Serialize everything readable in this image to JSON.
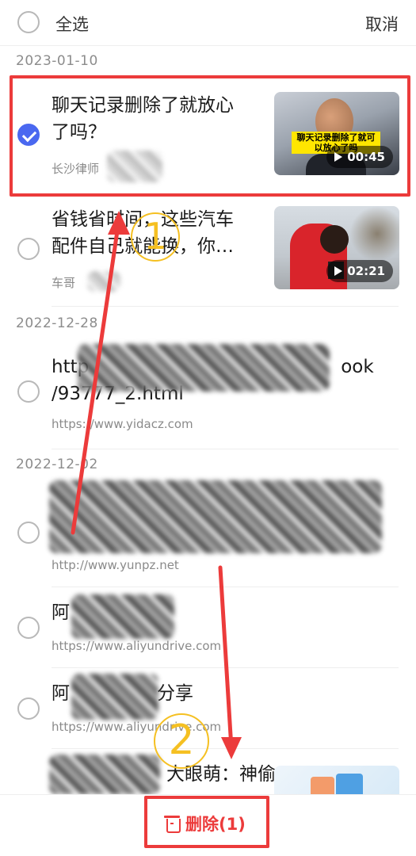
{
  "header": {
    "select_all": "全选",
    "cancel": "取消"
  },
  "groups": [
    {
      "date": "2023-01-10"
    },
    {
      "date": "2022-12-28"
    },
    {
      "date": "2022-12-02"
    }
  ],
  "items": [
    {
      "title_line1": "聊天记录删除了就放心",
      "title_line2": "了吗？",
      "source": "长沙律师",
      "thumb_caption": "聊天记录删除了就可以放心了吗",
      "duration": "00:45",
      "checked": true
    },
    {
      "title_line1": "省钱省时间，这些汽车",
      "title_line2": "配件自己就能换，你…",
      "source": "车哥",
      "duration": "02:21",
      "checked": false
    },
    {
      "title_line1": "http",
      "title_line1_end": "ook",
      "title_line2": "/93777_2.html",
      "source": "https://www.yidacz.com",
      "checked": false
    },
    {
      "source": "http://www.yunpz.net",
      "checked": false
    },
    {
      "title_prefix": "阿",
      "source": "https://www.aliyundrive.com",
      "checked": false
    },
    {
      "title_prefix": "阿",
      "title_suffix": "分享",
      "source": "https://www.aliyundrive.com",
      "checked": false
    },
    {
      "title_tail": "大眼萌：神偷",
      "checked": false
    }
  ],
  "footer": {
    "delete_label": "删除(1)"
  },
  "annotations": {
    "step1": "1",
    "step2": "2"
  },
  "colors": {
    "accent": "#4a68f0",
    "danger": "#ec3b3b",
    "step": "#f5c022"
  }
}
